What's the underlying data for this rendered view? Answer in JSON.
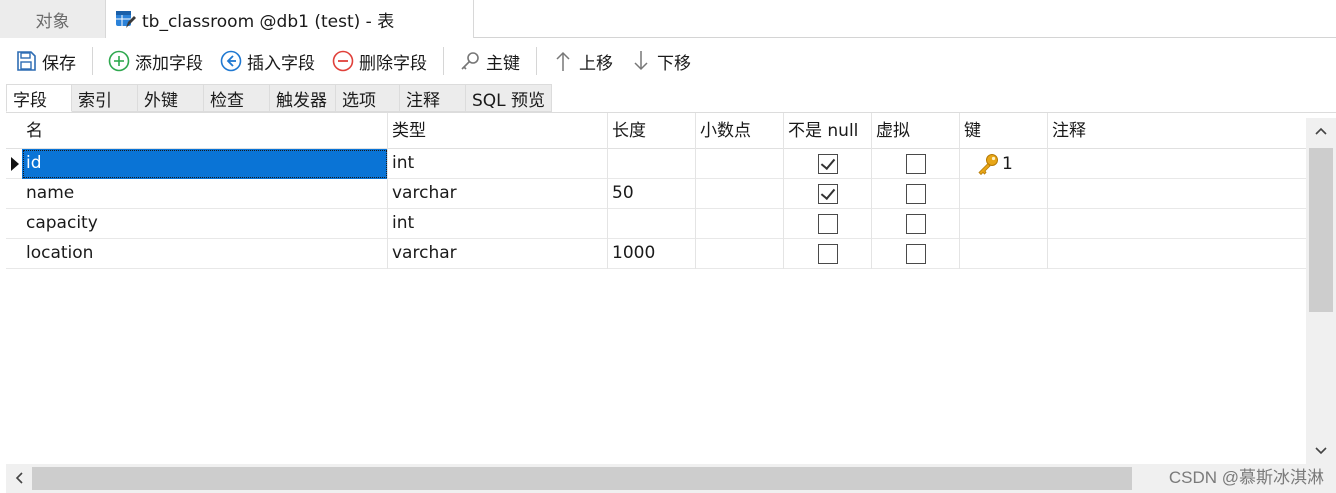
{
  "doc_tabs": {
    "objects_label": "对象",
    "active_label": "tb_classroom @db1 (test) - 表"
  },
  "toolbar": {
    "save": "保存",
    "add_field": "添加字段",
    "insert_field": "插入字段",
    "delete_field": "删除字段",
    "primary_key": "主键",
    "move_up": "上移",
    "move_down": "下移"
  },
  "inner_tabs": [
    "字段",
    "索引",
    "外键",
    "检查",
    "触发器",
    "选项",
    "注释",
    "SQL 预览"
  ],
  "grid": {
    "headers": [
      "名",
      "类型",
      "长度",
      "小数点",
      "不是 null",
      "虚拟",
      "键",
      "注释"
    ],
    "rows": [
      {
        "name": "id",
        "type": "int",
        "length": "",
        "decimals": "",
        "not_null": true,
        "virtual": false,
        "key": "1",
        "comment": ""
      },
      {
        "name": "name",
        "type": "varchar",
        "length": "50",
        "decimals": "",
        "not_null": true,
        "virtual": false,
        "key": "",
        "comment": ""
      },
      {
        "name": "capacity",
        "type": "int",
        "length": "",
        "decimals": "",
        "not_null": false,
        "virtual": false,
        "key": "",
        "comment": ""
      },
      {
        "name": "location",
        "type": "varchar",
        "length": "1000",
        "decimals": "",
        "not_null": false,
        "virtual": false,
        "key": "",
        "comment": ""
      }
    ]
  },
  "watermark": "CSDN @慕斯冰淇淋",
  "colors": {
    "selection": "#0a74d6",
    "key_icon": "#e8a617",
    "add_icon": "#2fa84f",
    "insert_icon": "#1f78d1",
    "delete_icon": "#e0403a"
  }
}
